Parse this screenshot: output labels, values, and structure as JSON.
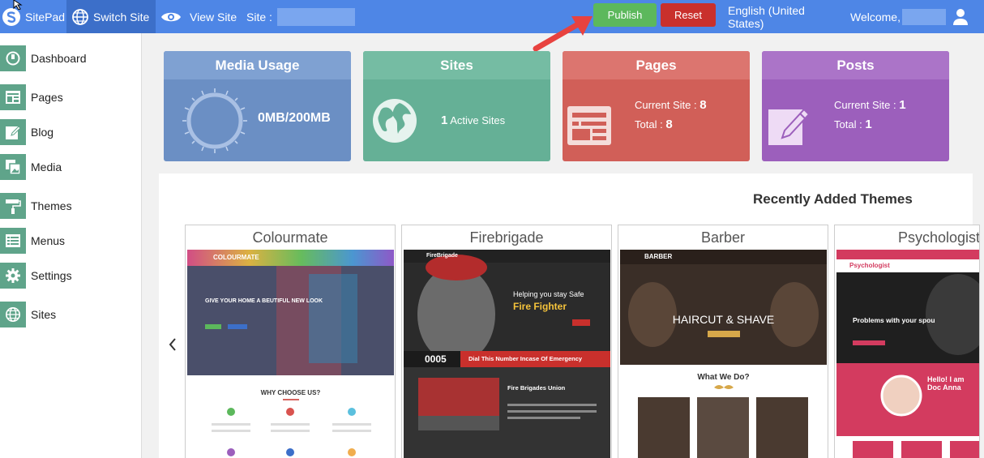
{
  "topbar": {
    "logo_label": "SitePad",
    "switch_label": "Switch Site",
    "view_label": "View Site",
    "site_label": "Site :",
    "publish_label": "Publish",
    "reset_label": "Reset",
    "language": "English (United States)",
    "welcome_label": "Welcome,"
  },
  "sidebar": {
    "items": [
      {
        "label": "Dashboard",
        "icon": "dashboard-icon"
      },
      {
        "label": "Pages",
        "icon": "pages-icon"
      },
      {
        "label": "Blog",
        "icon": "blog-icon"
      },
      {
        "label": "Media",
        "icon": "media-icon"
      },
      {
        "label": "Themes",
        "icon": "themes-icon"
      },
      {
        "label": "Menus",
        "icon": "menus-icon"
      },
      {
        "label": "Settings",
        "icon": "settings-icon"
      },
      {
        "label": "Sites",
        "icon": "sites-icon"
      }
    ]
  },
  "cards": {
    "media": {
      "title": "Media Usage",
      "value": "0MB/200MB"
    },
    "sites": {
      "title": "Sites",
      "count": "1",
      "label": "Active Sites"
    },
    "pages": {
      "title": "Pages",
      "current_label": "Current Site :",
      "current_value": "8",
      "total_label": "Total :",
      "total_value": "8"
    },
    "posts": {
      "title": "Posts",
      "current_label": "Current Site :",
      "current_value": "1",
      "total_label": "Total :",
      "total_value": "1"
    }
  },
  "themes": {
    "title": "Recently Added Themes",
    "items": [
      {
        "name": "Colourmate",
        "brand": "COLOURMATE",
        "headline": "GIVE YOUR HOME A BEUTIFUL NEW LOOK",
        "section": "WHY CHOOSE US?"
      },
      {
        "name": "Firebrigade",
        "brand": "FireBrigade",
        "headline": "Helping you stay Safe",
        "headline2": "Fire Fighter",
        "number": "0005",
        "banner": "Dial This Number Incase Of Emergency",
        "section": "Fire Brigades Union"
      },
      {
        "name": "Barber",
        "brand": "BARBER",
        "headline": "HAIRCUT & SHAVE",
        "section": "What We Do?"
      },
      {
        "name": "Psychologist",
        "brand": "Psychologist",
        "headline": "Problems with your spou",
        "section": "Hello! I am Doc Anna"
      }
    ]
  },
  "colors": {
    "topbar": "#4e86e6",
    "publish": "#5cb85c",
    "reset": "#c9302c",
    "media": "#6b8fc4",
    "sites": "#65b096",
    "pages": "#d15f58",
    "posts": "#9c5fbc"
  }
}
